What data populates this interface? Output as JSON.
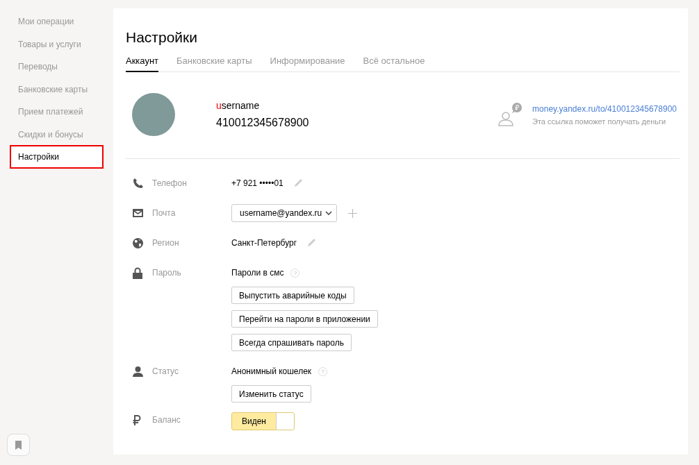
{
  "sidebar": {
    "items": [
      {
        "label": "Мои операции",
        "selected": false
      },
      {
        "label": "Товары и услуги",
        "selected": false
      },
      {
        "label": "Переводы",
        "selected": false
      },
      {
        "label": "Банковские карты",
        "selected": false
      },
      {
        "label": "Прием платежей",
        "selected": false
      },
      {
        "label": "Скидки и бонусы",
        "selected": false
      },
      {
        "label": "Настройки",
        "selected": true
      }
    ]
  },
  "page": {
    "title": "Настройки",
    "tabs": [
      {
        "label": "Аккаунт",
        "selected": true
      },
      {
        "label": "Банковские карты",
        "selected": false
      },
      {
        "label": "Информирование",
        "selected": false
      },
      {
        "label": "Всё остальное",
        "selected": false
      }
    ],
    "profile": {
      "username": "username",
      "account_number": "410012345678900",
      "link": "money.yandex.ru/to/410012345678900",
      "link_hint": "Эта ссылка поможет получать деньги"
    },
    "fields": [
      {
        "kind": "phone",
        "label": "Телефон",
        "value": "+7 921 •••••01",
        "editable": true
      },
      {
        "kind": "email",
        "label": "Почта",
        "value": "username@yandex.ru",
        "addable": true
      },
      {
        "kind": "region",
        "label": "Регион",
        "value": "Санкт-Петербург",
        "editable": true
      },
      {
        "kind": "password",
        "label": "Пароль",
        "value": "Пароли в смс",
        "hint": "?",
        "buttons": [
          "Выпустить аварийные коды",
          "Перейти на пароли в приложении",
          "Всегда спрашивать пароль"
        ]
      },
      {
        "kind": "status",
        "label": "Статус",
        "value": "Анонимный кошелек",
        "hint": "?",
        "buttons": [
          "Изменить статус"
        ]
      },
      {
        "kind": "balance",
        "label": "Баланс",
        "value": "Виден",
        "on": true
      }
    ]
  }
}
